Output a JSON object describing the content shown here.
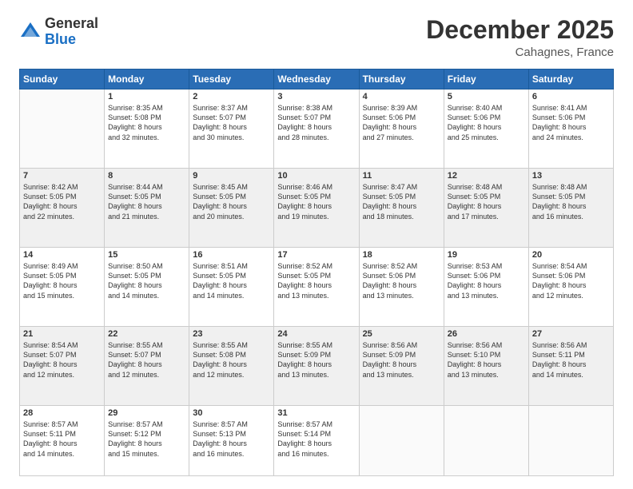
{
  "header": {
    "logo_general": "General",
    "logo_blue": "Blue",
    "month_title": "December 2025",
    "location": "Cahagnes, France"
  },
  "days_of_week": [
    "Sunday",
    "Monday",
    "Tuesday",
    "Wednesday",
    "Thursday",
    "Friday",
    "Saturday"
  ],
  "weeks": [
    {
      "row_class": "row-white",
      "days": [
        {
          "num": "",
          "info": ""
        },
        {
          "num": "1",
          "info": "Sunrise: 8:35 AM\nSunset: 5:08 PM\nDaylight: 8 hours\nand 32 minutes."
        },
        {
          "num": "2",
          "info": "Sunrise: 8:37 AM\nSunset: 5:07 PM\nDaylight: 8 hours\nand 30 minutes."
        },
        {
          "num": "3",
          "info": "Sunrise: 8:38 AM\nSunset: 5:07 PM\nDaylight: 8 hours\nand 28 minutes."
        },
        {
          "num": "4",
          "info": "Sunrise: 8:39 AM\nSunset: 5:06 PM\nDaylight: 8 hours\nand 27 minutes."
        },
        {
          "num": "5",
          "info": "Sunrise: 8:40 AM\nSunset: 5:06 PM\nDaylight: 8 hours\nand 25 minutes."
        },
        {
          "num": "6",
          "info": "Sunrise: 8:41 AM\nSunset: 5:06 PM\nDaylight: 8 hours\nand 24 minutes."
        }
      ]
    },
    {
      "row_class": "row-alt",
      "days": [
        {
          "num": "7",
          "info": "Sunrise: 8:42 AM\nSunset: 5:05 PM\nDaylight: 8 hours\nand 22 minutes."
        },
        {
          "num": "8",
          "info": "Sunrise: 8:44 AM\nSunset: 5:05 PM\nDaylight: 8 hours\nand 21 minutes."
        },
        {
          "num": "9",
          "info": "Sunrise: 8:45 AM\nSunset: 5:05 PM\nDaylight: 8 hours\nand 20 minutes."
        },
        {
          "num": "10",
          "info": "Sunrise: 8:46 AM\nSunset: 5:05 PM\nDaylight: 8 hours\nand 19 minutes."
        },
        {
          "num": "11",
          "info": "Sunrise: 8:47 AM\nSunset: 5:05 PM\nDaylight: 8 hours\nand 18 minutes."
        },
        {
          "num": "12",
          "info": "Sunrise: 8:48 AM\nSunset: 5:05 PM\nDaylight: 8 hours\nand 17 minutes."
        },
        {
          "num": "13",
          "info": "Sunrise: 8:48 AM\nSunset: 5:05 PM\nDaylight: 8 hours\nand 16 minutes."
        }
      ]
    },
    {
      "row_class": "row-white",
      "days": [
        {
          "num": "14",
          "info": "Sunrise: 8:49 AM\nSunset: 5:05 PM\nDaylight: 8 hours\nand 15 minutes."
        },
        {
          "num": "15",
          "info": "Sunrise: 8:50 AM\nSunset: 5:05 PM\nDaylight: 8 hours\nand 14 minutes."
        },
        {
          "num": "16",
          "info": "Sunrise: 8:51 AM\nSunset: 5:05 PM\nDaylight: 8 hours\nand 14 minutes."
        },
        {
          "num": "17",
          "info": "Sunrise: 8:52 AM\nSunset: 5:05 PM\nDaylight: 8 hours\nand 13 minutes."
        },
        {
          "num": "18",
          "info": "Sunrise: 8:52 AM\nSunset: 5:06 PM\nDaylight: 8 hours\nand 13 minutes."
        },
        {
          "num": "19",
          "info": "Sunrise: 8:53 AM\nSunset: 5:06 PM\nDaylight: 8 hours\nand 13 minutes."
        },
        {
          "num": "20",
          "info": "Sunrise: 8:54 AM\nSunset: 5:06 PM\nDaylight: 8 hours\nand 12 minutes."
        }
      ]
    },
    {
      "row_class": "row-alt",
      "days": [
        {
          "num": "21",
          "info": "Sunrise: 8:54 AM\nSunset: 5:07 PM\nDaylight: 8 hours\nand 12 minutes."
        },
        {
          "num": "22",
          "info": "Sunrise: 8:55 AM\nSunset: 5:07 PM\nDaylight: 8 hours\nand 12 minutes."
        },
        {
          "num": "23",
          "info": "Sunrise: 8:55 AM\nSunset: 5:08 PM\nDaylight: 8 hours\nand 12 minutes."
        },
        {
          "num": "24",
          "info": "Sunrise: 8:55 AM\nSunset: 5:09 PM\nDaylight: 8 hours\nand 13 minutes."
        },
        {
          "num": "25",
          "info": "Sunrise: 8:56 AM\nSunset: 5:09 PM\nDaylight: 8 hours\nand 13 minutes."
        },
        {
          "num": "26",
          "info": "Sunrise: 8:56 AM\nSunset: 5:10 PM\nDaylight: 8 hours\nand 13 minutes."
        },
        {
          "num": "27",
          "info": "Sunrise: 8:56 AM\nSunset: 5:11 PM\nDaylight: 8 hours\nand 14 minutes."
        }
      ]
    },
    {
      "row_class": "row-white",
      "days": [
        {
          "num": "28",
          "info": "Sunrise: 8:57 AM\nSunset: 5:11 PM\nDaylight: 8 hours\nand 14 minutes."
        },
        {
          "num": "29",
          "info": "Sunrise: 8:57 AM\nSunset: 5:12 PM\nDaylight: 8 hours\nand 15 minutes."
        },
        {
          "num": "30",
          "info": "Sunrise: 8:57 AM\nSunset: 5:13 PM\nDaylight: 8 hours\nand 16 minutes."
        },
        {
          "num": "31",
          "info": "Sunrise: 8:57 AM\nSunset: 5:14 PM\nDaylight: 8 hours\nand 16 minutes."
        },
        {
          "num": "",
          "info": ""
        },
        {
          "num": "",
          "info": ""
        },
        {
          "num": "",
          "info": ""
        }
      ]
    }
  ]
}
